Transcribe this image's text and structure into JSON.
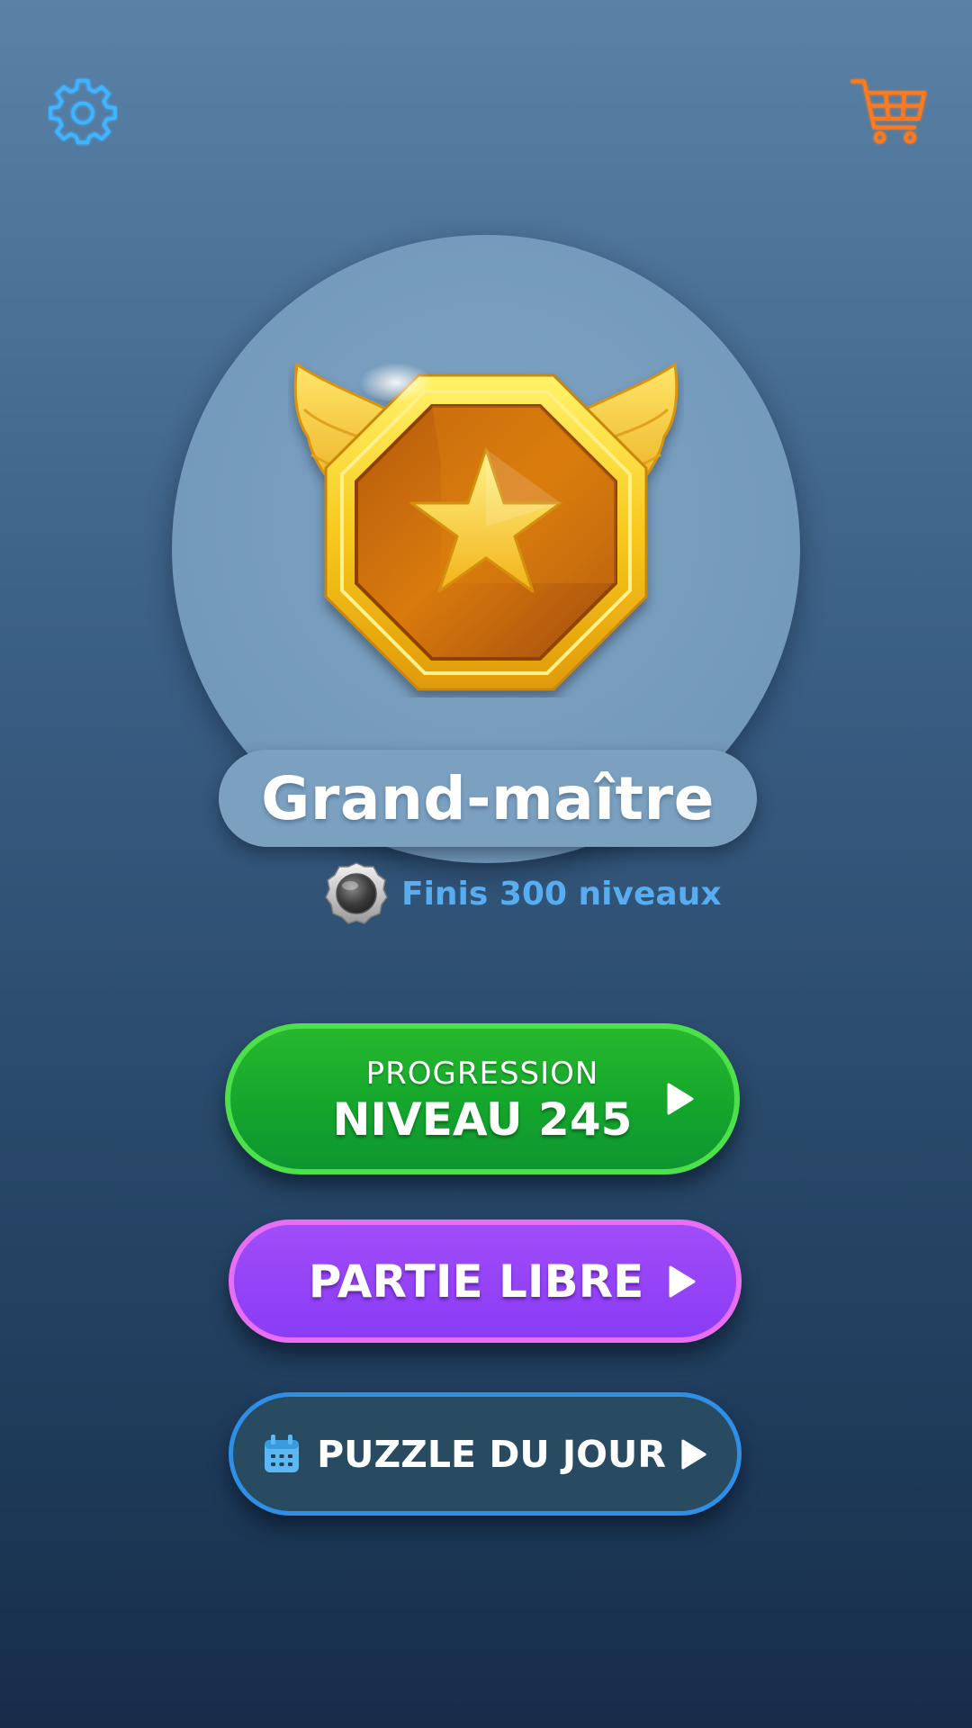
{
  "header": {
    "settings_icon": "gear-icon",
    "shop_icon": "shopping-cart-icon",
    "colors": {
      "settings": "#3fb4ff",
      "shop": "#ff7a1f"
    }
  },
  "rank": {
    "badge_icon": "winged-star-badge",
    "title": "Grand-maître",
    "next_requirement": {
      "icon": "silver-medal-icon",
      "text": "Finis 300 niveaux"
    }
  },
  "buttons": {
    "progression": {
      "line1": "PROGRESSION",
      "line2": "NIVEAU 245",
      "icon": "play-icon",
      "color": "#14a62c"
    },
    "free_play": {
      "label": "PARTIE LIBRE",
      "icon": "play-icon",
      "color": "#8a3cf5"
    },
    "daily_puzzle": {
      "label": "PUZZLE DU JOUR",
      "icon": "calendar-icon",
      "color": "#284b62"
    }
  }
}
